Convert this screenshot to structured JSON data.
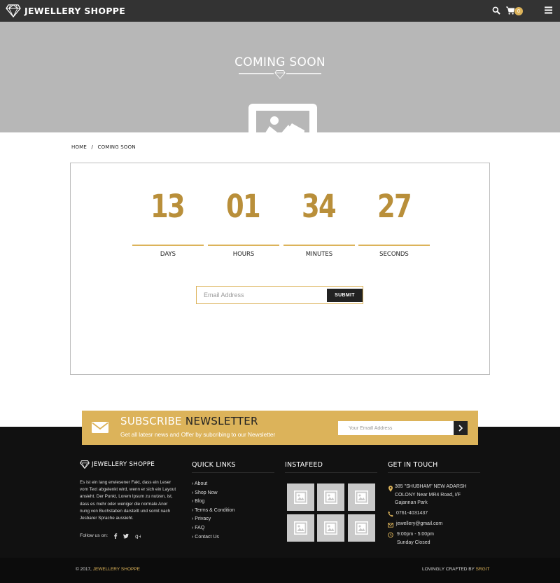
{
  "header": {
    "brand": "JEWELLERY SHOPPE",
    "cart_count": "0",
    "icons": [
      "search-icon",
      "cart-icon",
      "menu-icon"
    ]
  },
  "hero": {
    "title": "COMING SOON",
    "icons": [
      "diamond-icon",
      "image-placeholder-icon"
    ]
  },
  "breadcrumb": {
    "home": "HOME",
    "separator": "/",
    "current": "COMING SOON"
  },
  "countdown": {
    "days": "13",
    "hours": "01",
    "minutes": "34",
    "seconds": "27",
    "days_label": "DAYS",
    "hours_label": "HOURS",
    "minutes_label": "MINUTES",
    "seconds_label": "SECONDS"
  },
  "signup": {
    "placeholder": "Email Address",
    "submit_label": "SUBMIT"
  },
  "newsletter": {
    "title_light": "SUBSCRIBE",
    "title_dark": "NEWSLETTER",
    "subtitle": "Get all latesr news and Offer by subcribing to our Newsletter",
    "placeholder": "Your Emaill Address",
    "icons": [
      "envelope-icon",
      "chevron-right-icon"
    ]
  },
  "footer": {
    "brand": "JEWELLERY SHOPPE",
    "about": "Es ist ein lang erwiesener Fakt, dass ein Leser vom Text abgelenkt wird, wenn er sich ein Layout ansieht. Der Punkt, Lorem Ipsum zu nutzen, ist, dass es mehr oder weniger die normale Anor nung von Buchstaben darstellt und somit nach Jesbarer Sprache aussieht.",
    "follow_label": "Follow us on:",
    "social_icons": [
      "facebook-icon",
      "twitter-icon",
      "google-plus-icon"
    ],
    "quick_links_title": "QUICK LINKS",
    "quick_links": [
      "About",
      "Shop Now",
      "Blog",
      "Terms & Condition",
      "Privacy",
      "FAQ",
      "Contact Us"
    ],
    "instafeed_title": "INSTAFEED",
    "get_in_touch_title": "GET IN TOUCH",
    "address": "385 \"SHUBHAM\" NEW ADARSH COLONY Near MR4 Road, I/F Gajannan Park",
    "phone": "0761-4031437",
    "email": "jewellery@gmail.com",
    "hours": "9:00pm - 5:00pm",
    "closed": "Sunday Closed",
    "contact_icons": [
      "map-pin-icon",
      "phone-icon",
      "envelope-icon",
      "clock-icon"
    ],
    "copyright_prefix": "© 2017,",
    "copyright_brand": "JEWELLERY SHOPPE",
    "crafted_prefix": "LOVINGLY CRAFTED BY",
    "crafted_brand": "SRGIT"
  },
  "colors": {
    "gold": "#dcb35a",
    "countdown_gold": "#b98f3a",
    "header_bg": "#333333",
    "hero_bg": "#b7b7b7",
    "footer_bg": "#111111"
  }
}
